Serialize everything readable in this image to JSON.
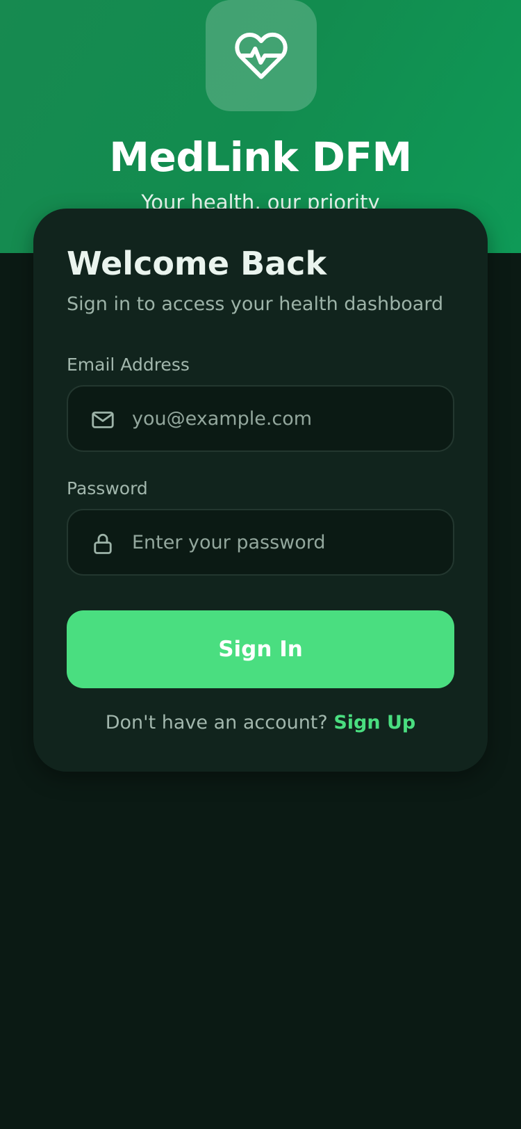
{
  "app": {
    "title": "MedLink DFM",
    "tagline": "Your health, our priority",
    "logo_icon": "heart-pulse-icon"
  },
  "login": {
    "heading": "Welcome Back",
    "subtitle": "Sign in to access your health dashboard",
    "email": {
      "label": "Email Address",
      "placeholder": "you@example.com",
      "value": "",
      "icon": "mail-icon"
    },
    "password": {
      "label": "Password",
      "placeholder": "Enter your password",
      "value": "",
      "icon": "lock-icon"
    },
    "submit_label": "Sign In",
    "signup_prompt": "Don't have an account?",
    "signup_link": "Sign Up"
  },
  "colors": {
    "hero_green": "#128c4f",
    "accent": "#4ade80",
    "background": "#0b1a14",
    "card": "#11241d"
  }
}
